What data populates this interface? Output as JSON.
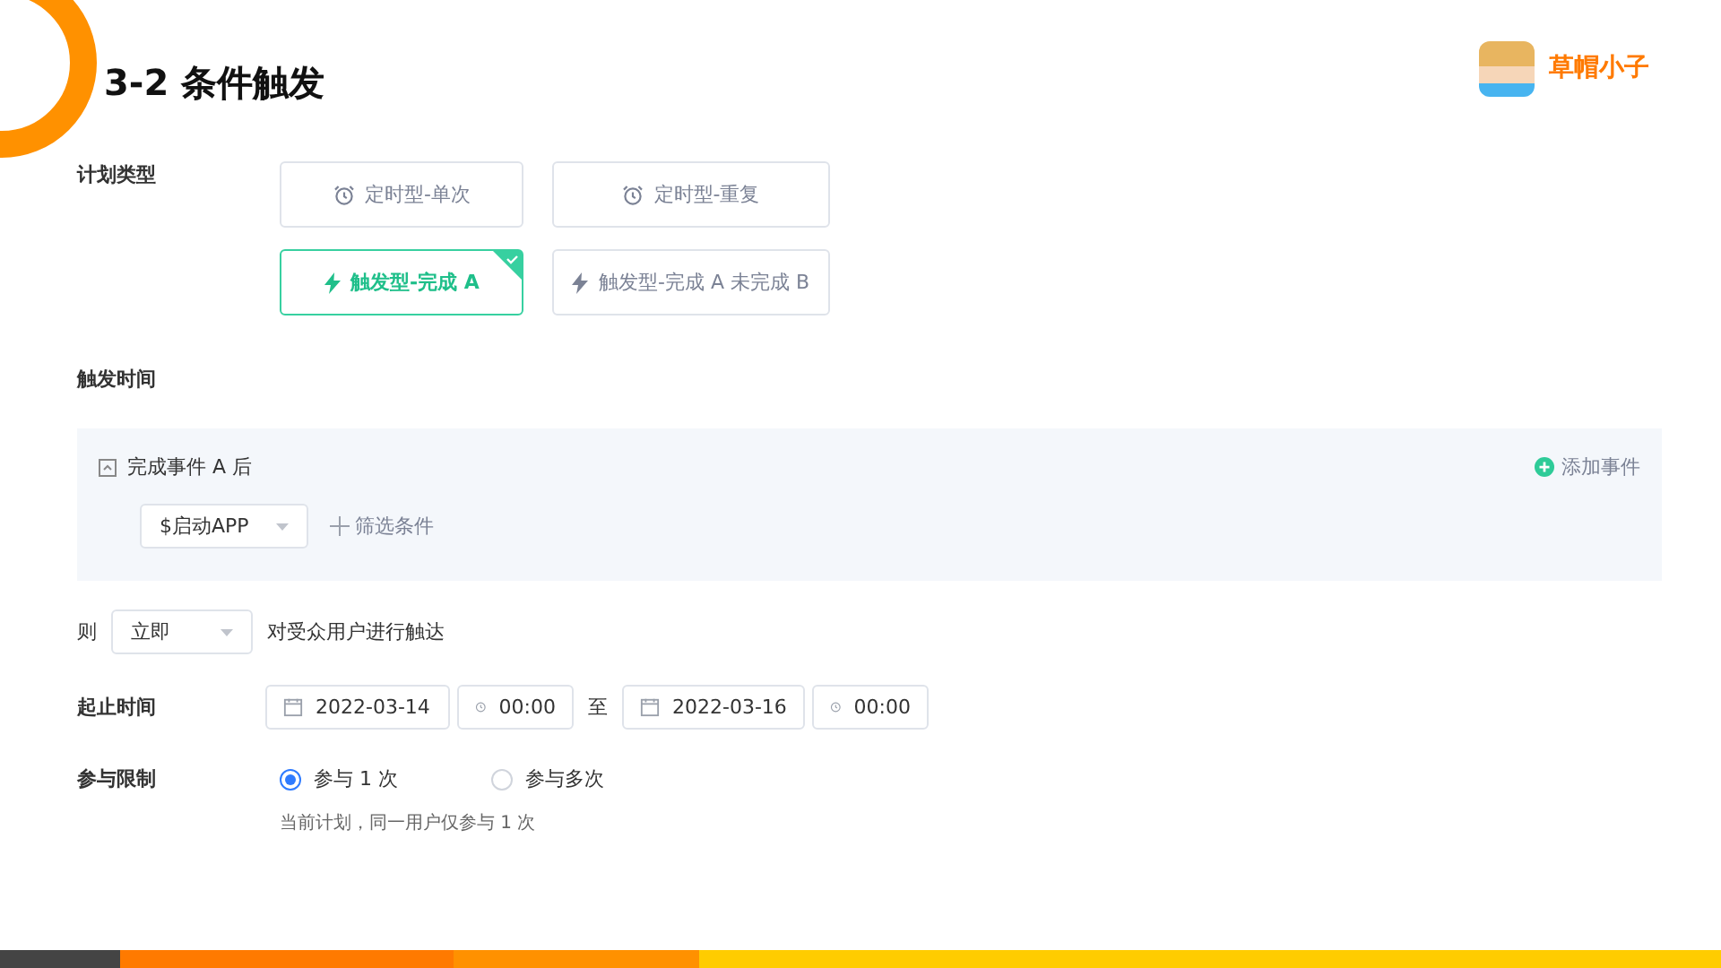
{
  "slide": {
    "title": "3-2 条件触发",
    "brand": "草帽小子"
  },
  "plan_type": {
    "label": "计划类型",
    "options": [
      {
        "kind": "timer",
        "label": "定时型-单次",
        "selected": false
      },
      {
        "kind": "timer",
        "label": "定时型-重复",
        "selected": false
      },
      {
        "kind": "trigger",
        "label": "触发型-完成 A",
        "selected": true
      },
      {
        "kind": "trigger",
        "label": "触发型-完成 A 未完成 B",
        "selected": false
      }
    ]
  },
  "trigger_time": {
    "label": "触发时间",
    "event": {
      "title": "完成事件 A 后",
      "event_select": "$启动APP",
      "filter_link": "筛选条件",
      "add_link": "添加事件"
    }
  },
  "then_row": {
    "prefix": "则",
    "timing_select": "立即",
    "suffix": "对受众用户进行触达"
  },
  "period": {
    "label": "起止时间",
    "start_date": "2022-03-14",
    "start_time": "00:00",
    "separator": "至",
    "end_date": "2022-03-16",
    "end_time": "00:00"
  },
  "limit": {
    "label": "参与限制",
    "options": [
      {
        "label": "参与 1 次",
        "selected": true
      },
      {
        "label": "参与多次",
        "selected": false
      }
    ],
    "hint": "当前计划，同一用户仅参与 1 次"
  }
}
